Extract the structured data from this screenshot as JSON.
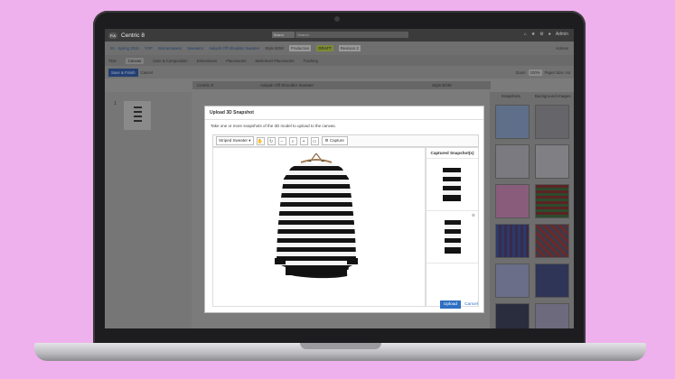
{
  "app": {
    "logo": "P.A",
    "title": "Centric 8",
    "search_select": "Brand",
    "search_placeholder": "Search",
    "user": "Admin"
  },
  "breadcrumb": [
    "01 - Spring 2018",
    "YOP",
    "Womenswear",
    "Sweaters",
    "Aaliyah Off Shoulder Sweater"
  ],
  "breadcrumb_tags": {
    "style_bom": "Style BOM",
    "production": "Production",
    "draft": "DRAFT",
    "revision": "Revision 2",
    "actions": "Actions"
  },
  "tabs": [
    "TDS",
    "Canvas",
    "Care & Composition",
    "Dimensions",
    "Placements",
    "Multi-level Placements",
    "Tracking"
  ],
  "active_tab": "Canvas",
  "toolbar": {
    "save_finish": "Save & Finish",
    "cancel": "Cancel",
    "zoom_label": "Zoom",
    "zoom_value": "100%",
    "paper_size": "Paper Size: A4"
  },
  "grid_header": {
    "c1": "Centric 8",
    "c2": "Aaliyah Off Shoulder Sweater",
    "c3": "Style BOM"
  },
  "thumb_number": "1",
  "right_panel": {
    "tab1": "Snapshots",
    "tab2": "Background images"
  },
  "modal": {
    "title": "Upload 3D Snapshot",
    "description": "Take one or more snapshots of the 3D model to upload to the canvas.",
    "model_select": "Striped Sweater",
    "capture_label": "Capture",
    "snapshots_title": "Captured Snapshot(s)",
    "upload_label": "Upload",
    "cancel_label": "Cancel"
  },
  "colors": {
    "background": "#efb0ee",
    "primary": "#2e6fc3",
    "draft": "#7c8b35"
  }
}
